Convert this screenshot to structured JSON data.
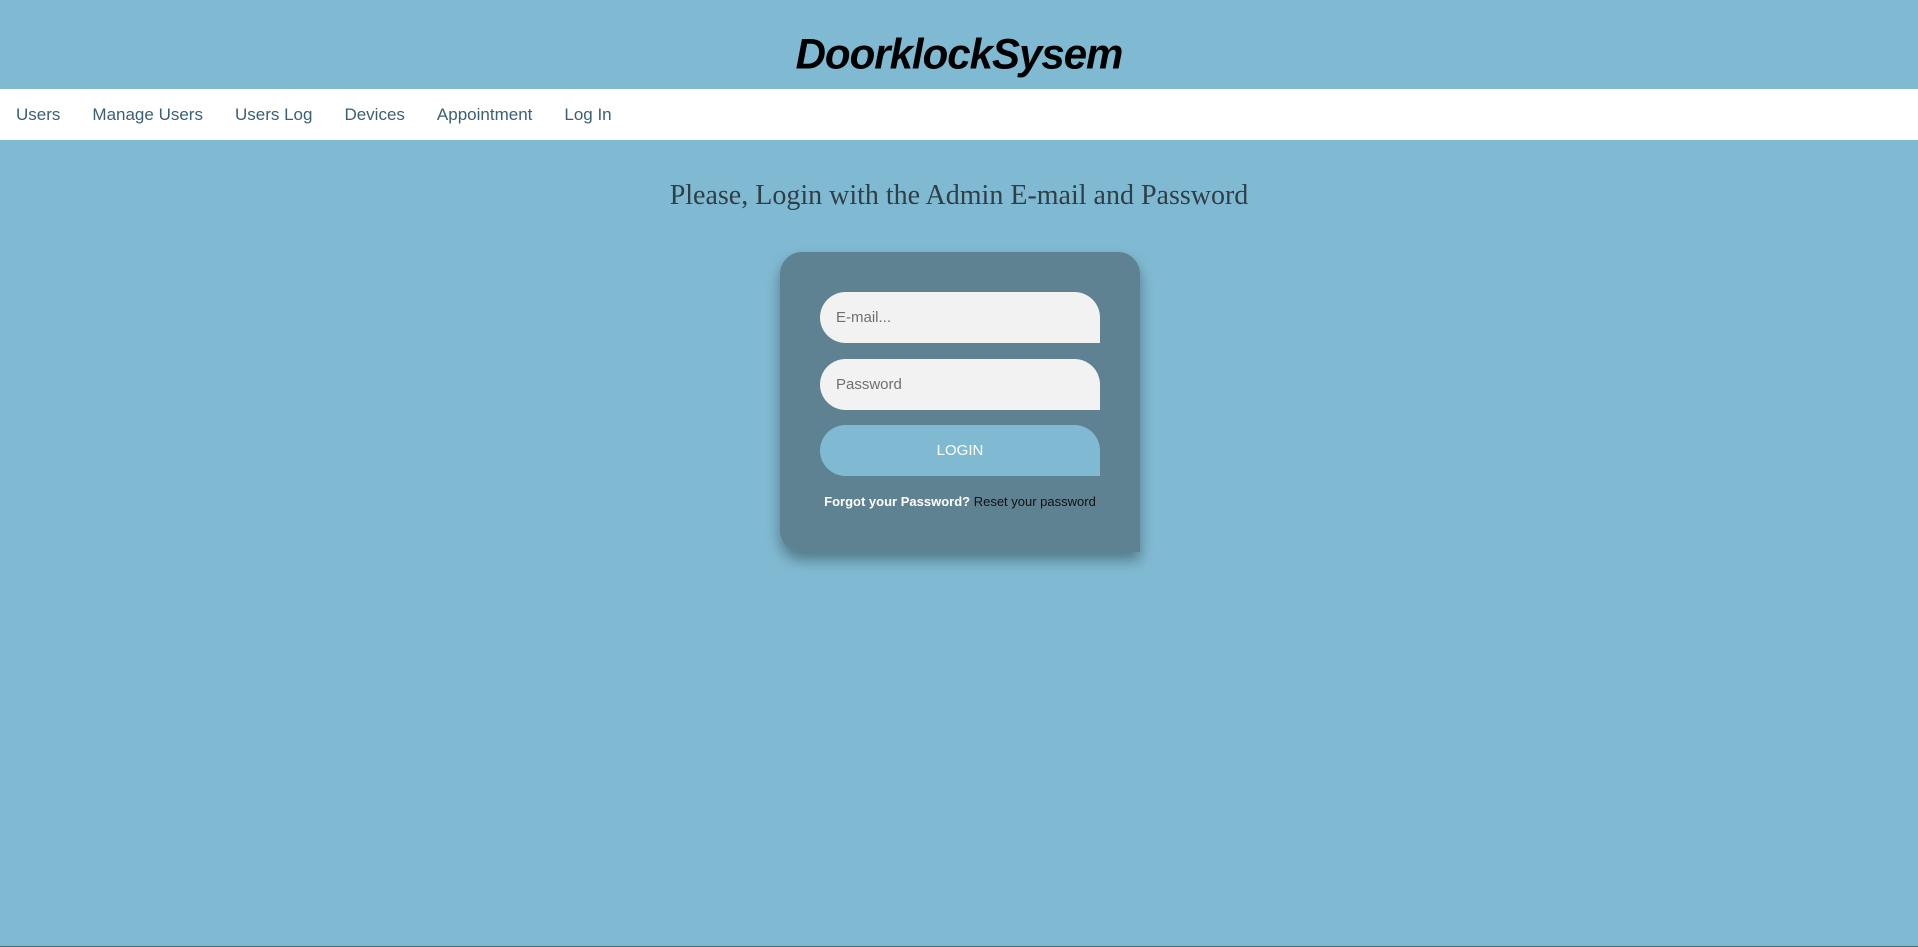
{
  "brand": {
    "title": "DoorklockSysem"
  },
  "nav": {
    "items": [
      {
        "label": "Users"
      },
      {
        "label": "Manage Users"
      },
      {
        "label": "Users Log"
      },
      {
        "label": "Devices"
      },
      {
        "label": "Appointment"
      },
      {
        "label": "Log In"
      }
    ]
  },
  "login": {
    "heading": "Please, Login with the Admin E-mail and Password",
    "email_placeholder": "E-mail...",
    "email_value": "",
    "password_placeholder": "Password",
    "password_value": "",
    "button_label": "LOGIN",
    "forgot_label": "Forgot your Password?",
    "reset_link": "Reset your password"
  },
  "colors": {
    "background": "#80bad2",
    "nav_background": "#ffffff",
    "nav_text": "#3b5f74",
    "card": "#5e8292",
    "input": "#f2f2f2",
    "button": "#80bad2"
  }
}
